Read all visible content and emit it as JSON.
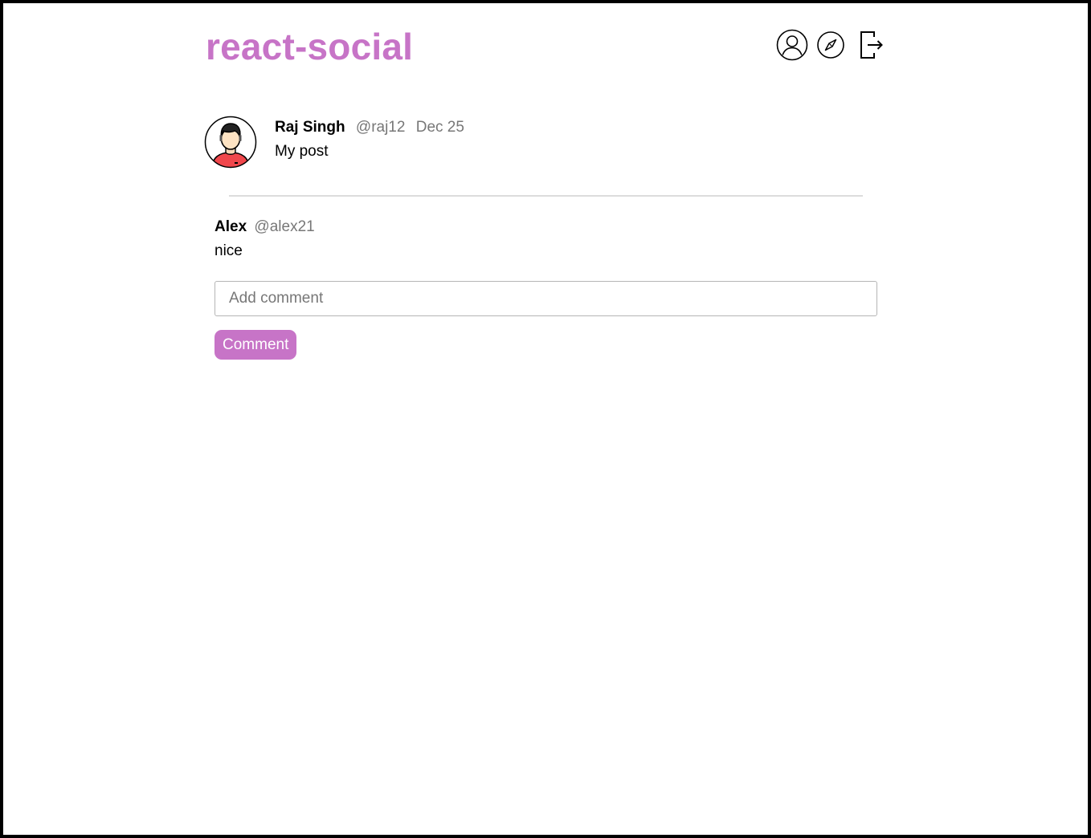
{
  "app": {
    "brand": "react-social",
    "accent_color": "#c774c7"
  },
  "nav": {
    "items": [
      {
        "icon": "user-circle-icon"
      },
      {
        "icon": "compass-icon"
      },
      {
        "icon": "logout-icon"
      }
    ]
  },
  "post": {
    "author_name": "Raj Singh",
    "author_handle": "@raj12",
    "date": "Dec 25",
    "text": "My post",
    "avatar_icon": "user-avatar-icon"
  },
  "comments": [
    {
      "author_name": "Alex",
      "author_handle": "@alex21",
      "text": "nice"
    }
  ],
  "comment_form": {
    "placeholder": "Add comment",
    "value": "",
    "button_label": "Comment"
  }
}
